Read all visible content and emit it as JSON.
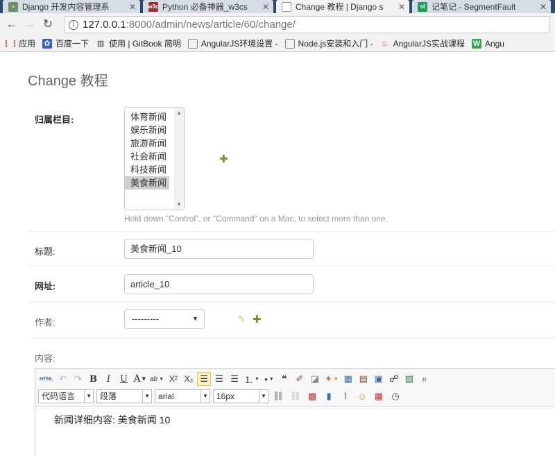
{
  "browser": {
    "tabs": [
      {
        "title": "Django 开发内容管理系"
      },
      {
        "title": "Python 必备神器_w3cs"
      },
      {
        "title": "Change 教程 | Django s"
      },
      {
        "title": "记笔记 - SegmentFault"
      }
    ],
    "favicons": {
      "w3c": "w3c",
      "sf": "sf"
    },
    "url": {
      "host": "127.0.0.1",
      "path": ":8000/admin/news/article/60/change/"
    },
    "bookmarks": [
      {
        "label": "应用"
      },
      {
        "label": "百度一下"
      },
      {
        "label": "使用 | GitBook 简明"
      },
      {
        "label": "AngularJS环境设置 -"
      },
      {
        "label": "Node.js安装和入门 -"
      },
      {
        "label": "AngularJS实战课程"
      },
      {
        "label": "Angu"
      }
    ],
    "bookmark_badge": "W"
  },
  "form": {
    "title": "Change 教程",
    "column_label": "归属栏目:",
    "column_options": [
      "体育新闻",
      "娱乐新闻",
      "旅游新闻",
      "社会新闻",
      "科技新闻",
      "美食新闻"
    ],
    "column_selected": "美食新闻",
    "column_help": "Hold down \"Control\", or \"Command\" on a Mac, to select more than one.",
    "title_label": "标题:",
    "title_value": "美食新闻_10",
    "slug_label": "网址:",
    "slug_value": "article_10",
    "author_label": "作者:",
    "author_value": "---------",
    "content_label": "内容:"
  },
  "editor": {
    "html_label": "HTML",
    "font_category": "代码语言",
    "paragraph": "段落",
    "font_family": "arial",
    "font_size": "16px",
    "content": "新闻详细内容: 美食新闻 10"
  },
  "colors": {
    "accent_green": "#5b9f2e",
    "tab_strip": "#2b4a72"
  }
}
